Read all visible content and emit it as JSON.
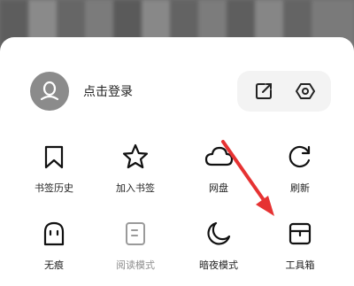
{
  "header": {
    "login_label": "点击登录"
  },
  "grid": [
    {
      "label": "书签历史",
      "icon": "bookmark-icon"
    },
    {
      "label": "加入书签",
      "icon": "star-icon"
    },
    {
      "label": "网盘",
      "icon": "cloud-icon"
    },
    {
      "label": "刷新",
      "icon": "refresh-icon"
    },
    {
      "label": "无痕",
      "icon": "ghost-icon"
    },
    {
      "label": "阅读模式",
      "icon": "reader-icon"
    },
    {
      "label": "暗夜模式",
      "icon": "moon-icon"
    },
    {
      "label": "工具箱",
      "icon": "toolbox-icon"
    }
  ],
  "colors": {
    "arrow": "#e63232",
    "disabled": "#8e8e8e",
    "avatar": "#8b8b8b",
    "pill": "#f3f3f3"
  }
}
